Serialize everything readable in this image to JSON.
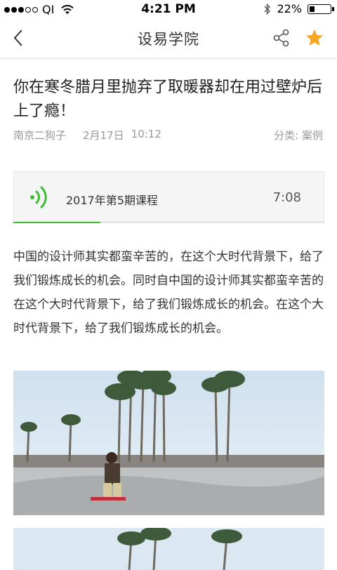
{
  "status_bar": {
    "carrier": "QI",
    "time": "4:21 PM",
    "battery_text": "22%",
    "battery_level": 0.22
  },
  "nav": {
    "title": "设易学院",
    "star_color": "#f5a623"
  },
  "article": {
    "title": "你在寒冬腊月里抛弃了取暖器却在用过壁炉后上了瘾！",
    "author": "南京二狗子",
    "date": "2月17日",
    "time": "10:12",
    "category": "分类: 案例",
    "audio": {
      "title": "2017年第5期课程",
      "duration": "7:08",
      "progress": 0.28,
      "accent_color": "#3fbe35"
    },
    "body": "中国的设计师其实都蛮辛苦的，在这个大时代背景下，给了我们锻炼成长的机会。同时自中国的设计师其实都蛮辛苦的在这个大时代背景下，给了我们锻炼成长的机会。在这个大时代背景下，给了我们锻炼成长的机会。",
    "images": [
      {
        "icon": "skatepark-photo"
      },
      {
        "icon": "skatepark-photo"
      }
    ]
  }
}
